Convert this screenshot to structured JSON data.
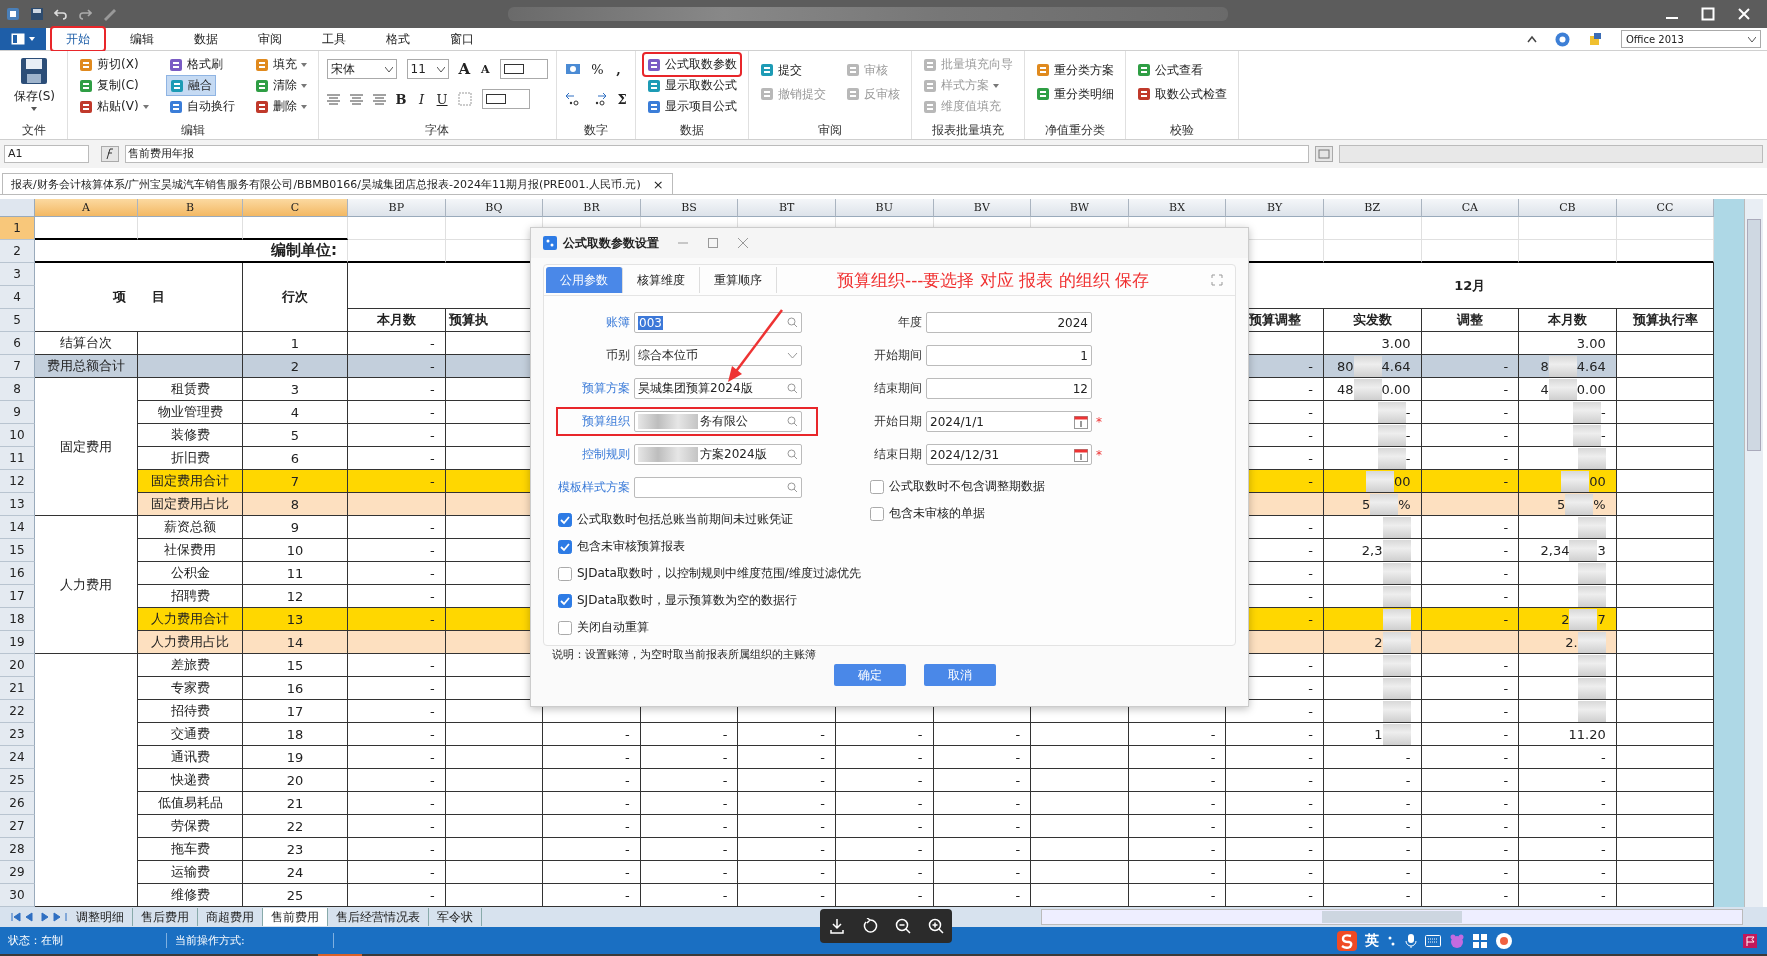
{
  "menu_tabs": [
    {
      "label": "开始",
      "selected": true,
      "annotated": true
    },
    {
      "label": "编辑",
      "selected": false,
      "annotated": false
    },
    {
      "label": "数据",
      "selected": false,
      "annotated": false
    },
    {
      "label": "审阅",
      "selected": false,
      "annotated": false
    },
    {
      "label": "工具",
      "selected": false,
      "annotated": false
    },
    {
      "label": "格式",
      "selected": false,
      "annotated": false
    },
    {
      "label": "窗口",
      "selected": false,
      "annotated": false
    }
  ],
  "view_select": "Office 2013",
  "ribbon": [
    {
      "kind": "large",
      "label": "文件",
      "items": [
        {
          "label": "保存(S)",
          "dropdown": true,
          "disabled": false,
          "selected": false,
          "annotated": false
        }
      ]
    },
    {
      "kind": "stack3",
      "label": "编辑",
      "items": [
        {
          "label": "剪切(X)",
          "dropdown": false,
          "disabled": false,
          "selected": false,
          "annotated": false
        },
        {
          "label": "复制(C)",
          "dropdown": false,
          "disabled": false,
          "selected": false,
          "annotated": false
        },
        {
          "label": "粘贴(V)",
          "dropdown": true,
          "disabled": false,
          "selected": false,
          "annotated": false
        },
        {
          "label": "格式刷",
          "dropdown": false,
          "disabled": false,
          "selected": false,
          "annotated": false
        },
        {
          "label": "融合",
          "dropdown": false,
          "disabled": false,
          "selected": true,
          "annotated": false
        },
        {
          "label": "自动换行",
          "dropdown": false,
          "disabled": false,
          "selected": false,
          "annotated": false
        },
        {
          "label": "填充",
          "dropdown": true,
          "disabled": false,
          "selected": false,
          "annotated": false
        },
        {
          "label": "清除",
          "dropdown": true,
          "disabled": false,
          "selected": false,
          "annotated": false
        },
        {
          "label": "删除",
          "dropdown": true,
          "disabled": false,
          "selected": false,
          "annotated": false
        }
      ]
    },
    {
      "kind": "font",
      "label": "字体",
      "font": "宋体",
      "size": "11",
      "grow": "A",
      "shrink": "A",
      "bold": "B",
      "italic": "I",
      "underline": "U"
    },
    {
      "kind": "number",
      "label": "数字",
      "percent": "%",
      "comma": ",",
      "sum": "Σ"
    },
    {
      "kind": "stack3",
      "label": "数据",
      "items": [
        {
          "label": "公式取数参数",
          "dropdown": false,
          "disabled": false,
          "selected": false,
          "annotated": true
        },
        {
          "label": "显示取数公式",
          "dropdown": false,
          "disabled": false,
          "selected": false,
          "annotated": false
        },
        {
          "label": "显示项目公式",
          "dropdown": false,
          "disabled": false,
          "selected": false,
          "annotated": false
        }
      ]
    },
    {
      "kind": "stack2",
      "label": "审阅",
      "items": [
        {
          "label": "提交",
          "dropdown": false,
          "disabled": false,
          "selected": false,
          "annotated": false
        },
        {
          "label": "撤销提交",
          "dropdown": false,
          "disabled": true,
          "selected": false,
          "annotated": false
        },
        {
          "label": "审核",
          "dropdown": false,
          "disabled": true,
          "selected": false,
          "annotated": false
        },
        {
          "label": "反审核",
          "dropdown": false,
          "disabled": true,
          "selected": false,
          "annotated": false
        }
      ]
    },
    {
      "kind": "stack3",
      "label": "报表批量填充",
      "items": [
        {
          "label": "批量填充向导",
          "dropdown": false,
          "disabled": true,
          "selected": false,
          "annotated": false
        },
        {
          "label": "样式方案",
          "dropdown": true,
          "disabled": true,
          "selected": false,
          "annotated": false
        },
        {
          "label": "维度值填充",
          "dropdown": false,
          "disabled": true,
          "selected": false,
          "annotated": false
        }
      ]
    },
    {
      "kind": "stack2",
      "label": "净值重分类",
      "items": [
        {
          "label": "重分类方案",
          "dropdown": false,
          "disabled": false,
          "selected": false,
          "annotated": false
        },
        {
          "label": "重分类明细",
          "dropdown": false,
          "disabled": false,
          "selected": false,
          "annotated": false
        }
      ]
    },
    {
      "kind": "stack2",
      "label": "校验",
      "items": [
        {
          "label": "公式查看",
          "dropdown": false,
          "disabled": false,
          "selected": false,
          "annotated": false
        },
        {
          "label": "取数公式检查",
          "dropdown": false,
          "disabled": false,
          "selected": false,
          "annotated": false
        }
      ]
    }
  ],
  "formula_bar": {
    "cell": "A1",
    "content": "售前费用年报"
  },
  "doc_tab": {
    "label": "报表/财务会计核算体系/广州宝昊城汽车销售服务有限公司/BBMB0166/昊城集团店总报表-2024年11期月报(PRE001.人民币.元)",
    "close": "×"
  },
  "sheet": {
    "columns": [
      {
        "label": "A",
        "selected": true
      },
      {
        "label": "B",
        "selected": true
      },
      {
        "label": "C",
        "selected": true
      },
      {
        "label": "BP",
        "selected": false
      },
      {
        "label": "BQ",
        "selected": false
      },
      {
        "label": "BR",
        "selected": false
      },
      {
        "label": "BS",
        "selected": false
      },
      {
        "label": "BT",
        "selected": false
      },
      {
        "label": "BU",
        "selected": false
      },
      {
        "label": "BV",
        "selected": false
      },
      {
        "label": "BW",
        "selected": false
      },
      {
        "label": "BX",
        "selected": false
      },
      {
        "label": "BY",
        "selected": false
      },
      {
        "label": "BZ",
        "selected": false
      },
      {
        "label": "CA",
        "selected": false
      },
      {
        "label": "CB",
        "selected": false
      },
      {
        "label": "CC",
        "selected": false
      }
    ],
    "rows": [
      {
        "n": "1",
        "kind": "blank",
        "selected": true
      },
      {
        "n": "2",
        "kind": "title",
        "selected": false,
        "cells": [
          "编制单位:",
          null,
          null,
          null,
          null,
          null,
          null,
          null,
          null,
          null,
          null,
          null,
          null,
          null,
          null,
          null,
          null
        ]
      },
      {
        "n": "3",
        "kind": "header",
        "selected": false,
        "cells": [
          "项　　目",
          null,
          "行次",
          null,
          null,
          null,
          null,
          null,
          null,
          null,
          null,
          null,
          "12月",
          null,
          null,
          null,
          null
        ]
      },
      {
        "n": "4",
        "selected": false
      },
      {
        "n": "5",
        "kind": "header",
        "selected": false,
        "cells": [
          null,
          null,
          null,
          "本月数",
          "预算执",
          null,
          null,
          null,
          null,
          null,
          null,
          null,
          "预算调整",
          "实发数",
          "调整",
          "本月数",
          "预算执行率"
        ]
      },
      {
        "n": "6",
        "kind": "normal",
        "selected": false,
        "cells": [
          "结算台次",
          null,
          "1",
          "-",
          null,
          null,
          null,
          null,
          null,
          null,
          null,
          null,
          null,
          "3.00",
          null,
          "3.00",
          null
        ]
      },
      {
        "n": "7",
        "kind": "sum",
        "selected": false,
        "cells": [
          "费用总额合计",
          null,
          "2",
          "-",
          null,
          null,
          null,
          null,
          null,
          null,
          null,
          null,
          "-",
          {
            "l": "80",
            "r": "4.64",
            "blurred": true
          },
          "-",
          {
            "l": "8",
            "r": "4.64",
            "blurred": true
          },
          null
        ]
      },
      {
        "n": "8",
        "kind": "normal",
        "selected": false,
        "cells": [
          "固定费用",
          "租赁费",
          "3",
          "-",
          null,
          null,
          null,
          null,
          null,
          null,
          null,
          null,
          "-",
          {
            "l": "48",
            "r": "0.00",
            "blurred": true
          },
          "-",
          {
            "l": "4",
            "r": "0.00",
            "blurred": true
          },
          null
        ]
      },
      {
        "n": "9",
        "kind": "normal",
        "selected": false,
        "cells": [
          null,
          "物业管理费",
          "4",
          "-",
          null,
          null,
          null,
          null,
          null,
          null,
          null,
          null,
          "-",
          {
            "r": "-",
            "blurred": true
          },
          "-",
          {
            "r": "-",
            "blurred": true
          },
          null
        ]
      },
      {
        "n": "10",
        "kind": "normal",
        "selected": false,
        "cells": [
          null,
          "装修费",
          "5",
          "-",
          null,
          null,
          null,
          null,
          null,
          null,
          null,
          null,
          "-",
          {
            "r": "-",
            "blurred": true
          },
          "-",
          {
            "r": "-",
            "blurred": true
          },
          null
        ]
      },
      {
        "n": "11",
        "kind": "normal",
        "selected": false,
        "cells": [
          null,
          "折旧费",
          "6",
          "-",
          null,
          null,
          null,
          null,
          null,
          null,
          null,
          null,
          "-",
          {
            "r": "-",
            "blurred": true
          },
          "-",
          {
            "blurred": true
          },
          null
        ]
      },
      {
        "n": "12",
        "kind": "total",
        "selected": false,
        "cells": [
          null,
          "固定费用合计",
          "7",
          "-",
          null,
          null,
          null,
          null,
          null,
          null,
          null,
          null,
          "-",
          {
            "r": "00",
            "blurred": true
          },
          "-",
          {
            "r": "00",
            "blurred": true
          },
          null
        ]
      },
      {
        "n": "13",
        "kind": "ratio",
        "selected": false,
        "cells": [
          null,
          "固定费用占比",
          "8",
          null,
          null,
          null,
          null,
          null,
          null,
          null,
          null,
          null,
          null,
          {
            "l": "5",
            "r": "%",
            "blurred": true
          },
          null,
          {
            "l": "5",
            "r": "%",
            "blurred": true
          },
          null
        ]
      },
      {
        "n": "14",
        "kind": "normal",
        "selected": false,
        "cells": [
          "人力费用",
          "薪资总额",
          "9",
          "-",
          null,
          null,
          null,
          null,
          null,
          null,
          null,
          null,
          "-",
          {
            "blurred": true
          },
          "-",
          {
            "blurred": true
          },
          null
        ]
      },
      {
        "n": "15",
        "kind": "normal",
        "selected": false,
        "cells": [
          null,
          "社保费用",
          "10",
          "-",
          null,
          null,
          null,
          null,
          null,
          null,
          null,
          null,
          "-",
          {
            "l": "2,3",
            "blurred": true
          },
          "-",
          {
            "l": "2,34",
            "r": "3",
            "blurred": true
          },
          null
        ]
      },
      {
        "n": "16",
        "kind": "normal",
        "selected": false,
        "cells": [
          null,
          "公积金",
          "11",
          "-",
          null,
          null,
          null,
          null,
          null,
          null,
          null,
          null,
          "-",
          {
            "blurred": true
          },
          "-",
          {
            "blurred": true
          },
          null
        ]
      },
      {
        "n": "17",
        "kind": "normal",
        "selected": false,
        "cells": [
          null,
          "招聘费",
          "12",
          "-",
          null,
          null,
          null,
          null,
          null,
          null,
          null,
          null,
          "-",
          {
            "blurred": true
          },
          "-",
          {
            "blurred": true
          },
          null
        ]
      },
      {
        "n": "18",
        "kind": "total",
        "selected": false,
        "cells": [
          null,
          "人力费用合计",
          "13",
          "-",
          null,
          null,
          null,
          null,
          null,
          null,
          null,
          null,
          "-",
          {
            "blurred": true
          },
          "-",
          {
            "l": "2",
            "r": "7",
            "blurred": true
          },
          null
        ]
      },
      {
        "n": "19",
        "kind": "ratio",
        "selected": false,
        "cells": [
          null,
          "人力费用占比",
          "14",
          null,
          null,
          null,
          null,
          null,
          null,
          null,
          null,
          null,
          null,
          {
            "l": "2",
            "blurred": true
          },
          null,
          {
            "l": "2.",
            "blurred": true
          },
          null
        ]
      },
      {
        "n": "20",
        "kind": "normal",
        "selected": false,
        "cells": [
          null,
          "差旅费",
          "15",
          "-",
          null,
          null,
          null,
          null,
          null,
          null,
          null,
          null,
          "-",
          {
            "blurred": true
          },
          "-",
          {
            "blurred": true
          },
          null
        ]
      },
      {
        "n": "21",
        "kind": "normal",
        "selected": false,
        "cells": [
          null,
          "专家费",
          "16",
          "-",
          null,
          null,
          null,
          null,
          null,
          null,
          null,
          null,
          "-",
          {
            "blurred": true
          },
          "-",
          {
            "blurred": true
          },
          null
        ]
      },
      {
        "n": "22",
        "kind": "normal",
        "selected": false,
        "cells": [
          null,
          "招待费",
          "17",
          "-",
          null,
          null,
          null,
          null,
          null,
          null,
          null,
          null,
          "-",
          {
            "blurred": true
          },
          "-",
          {
            "blurred": true
          },
          null
        ]
      },
      {
        "n": "23",
        "kind": "normal",
        "selected": false,
        "cells": [
          null,
          "交通费",
          "18",
          "-",
          null,
          "-",
          "-",
          "-",
          "-",
          "-",
          null,
          "-",
          "-",
          {
            "l": "1",
            "blurred": true
          },
          "-",
          "11.20",
          null
        ]
      },
      {
        "n": "24",
        "kind": "normal",
        "selected": false,
        "cells": [
          null,
          "通讯费",
          "19",
          "-",
          null,
          "-",
          "-",
          "-",
          "-",
          "-",
          null,
          "-",
          "-",
          "-",
          "-",
          "-",
          null
        ]
      },
      {
        "n": "25",
        "kind": "normal",
        "selected": false,
        "cells": [
          null,
          "快递费",
          "20",
          "-",
          null,
          "-",
          "-",
          "-",
          "-",
          "-",
          null,
          "-",
          "-",
          "-",
          "-",
          "-",
          null
        ]
      },
      {
        "n": "26",
        "kind": "normal",
        "selected": false,
        "cells": [
          null,
          "低值易耗品",
          "21",
          "-",
          null,
          "-",
          "-",
          "-",
          "-",
          "-",
          null,
          "-",
          "-",
          "-",
          "-",
          "-",
          null
        ]
      },
      {
        "n": "27",
        "kind": "normal",
        "selected": false,
        "cells": [
          null,
          "劳保费",
          "22",
          "-",
          null,
          "-",
          "-",
          "-",
          "-",
          "-",
          null,
          "-",
          "-",
          "-",
          "-",
          "-",
          null
        ]
      },
      {
        "n": "28",
        "kind": "normal",
        "selected": false,
        "cells": [
          null,
          "拖车费",
          "23",
          "-",
          null,
          "-",
          "-",
          "-",
          "-",
          "-",
          null,
          "-",
          "-",
          "-",
          "-",
          "-",
          null
        ]
      },
      {
        "n": "29",
        "kind": "normal",
        "selected": false,
        "cells": [
          null,
          "运输费",
          "24",
          "-",
          null,
          "-",
          "-",
          "-",
          "-",
          "-",
          null,
          "-",
          "-",
          "-",
          "-",
          "-",
          null
        ]
      },
      {
        "n": "30",
        "kind": "normal",
        "selected": false,
        "cells": [
          null,
          "维修费",
          "25",
          "-",
          null,
          "-",
          "-",
          "-",
          "-",
          "-",
          null,
          "-",
          "-",
          "-",
          "-",
          "-",
          null
        ]
      }
    ]
  },
  "dialog": {
    "title": "公式取数参数设置",
    "tabs": [
      {
        "label": "公用参数",
        "selected": true
      },
      {
        "label": "核算维度",
        "selected": false
      },
      {
        "label": "重算顺序",
        "selected": false
      }
    ],
    "annotation": "预算组织---要选择 对应 报表 的组织 保存",
    "left_fields": [
      {
        "label": "账簿",
        "link": true,
        "kind": "search",
        "value": "003",
        "value_selected": true,
        "blurred": false,
        "annotated": false
      },
      {
        "label": "币别",
        "link": false,
        "kind": "dropdown",
        "value": "综合本位币",
        "value_selected": false,
        "blurred": false,
        "annotated": false
      },
      {
        "label": "预算方案",
        "link": true,
        "kind": "search",
        "value": "昊城集团预算2024版",
        "value_selected": false,
        "blurred": false,
        "annotated": false
      },
      {
        "label": "预算组织",
        "link": true,
        "kind": "search",
        "value": "务有限公",
        "value_selected": false,
        "blurred": true,
        "annotated": true
      },
      {
        "label": "控制规则",
        "link": true,
        "kind": "search",
        "value": "方案2024版",
        "value_selected": false,
        "blurred": true,
        "annotated": false
      },
      {
        "label": "模板样式方案",
        "link": true,
        "kind": "search",
        "blurred": false,
        "annotated": false
      }
    ],
    "left_checks": [
      {
        "label": "公式取数时包括总账当前期间未过账凭证",
        "checked": true
      },
      {
        "label": "包含未审核预算报表",
        "checked": true
      },
      {
        "label": "SJData取数时，以控制规则中维度范围/维度过滤优先",
        "checked": false
      },
      {
        "label": "SJData取数时，显示预算数为空的数据行",
        "checked": true
      },
      {
        "label": "关闭自动重算",
        "checked": false
      }
    ],
    "right_fields": [
      {
        "label": "年度",
        "kind": "number",
        "value": "2024"
      },
      {
        "label": "开始期间",
        "kind": "number",
        "value": "1"
      },
      {
        "label": "结束期间",
        "kind": "number",
        "value": "12"
      },
      {
        "label": "开始日期",
        "kind": "date",
        "value": "2024/1/1",
        "required": "*"
      },
      {
        "label": "结束日期",
        "kind": "date",
        "value": "2024/12/31",
        "required": "*"
      }
    ],
    "right_checks": [
      {
        "label": "公式取数时不包含调整期数据",
        "checked": false
      },
      {
        "label": "包含未审核的单据",
        "checked": false
      }
    ],
    "note": "说明：设置账簿，为空时取当前报表所属组织的主账簿",
    "buttons": [
      "确定",
      "取消"
    ]
  },
  "sheet_tabs": [
    {
      "label": "调整明细",
      "selected": false
    },
    {
      "label": "售后费用",
      "selected": false
    },
    {
      "label": "商超费用",
      "selected": false
    },
    {
      "label": "售前费用",
      "selected": true
    },
    {
      "label": "售后经营情况表",
      "selected": false
    },
    {
      "label": "军令状",
      "selected": false
    }
  ],
  "status_bar": [
    "状态：在制",
    "当前操作方式:"
  ],
  "ime": {
    "lang": "英"
  }
}
